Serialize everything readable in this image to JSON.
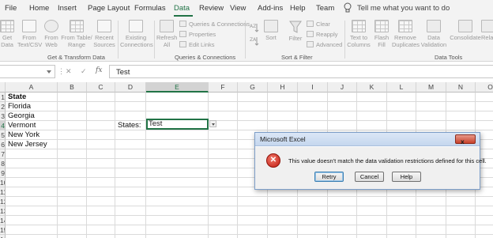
{
  "ribbon_tabs": [
    {
      "id": "file",
      "label": "File"
    },
    {
      "id": "home",
      "label": "Home"
    },
    {
      "id": "insert",
      "label": "Insert"
    },
    {
      "id": "page_layout",
      "label": "Page Layout"
    },
    {
      "id": "formulas",
      "label": "Formulas"
    },
    {
      "id": "data",
      "label": "Data",
      "active": true
    },
    {
      "id": "review",
      "label": "Review"
    },
    {
      "id": "view",
      "label": "View"
    },
    {
      "id": "addins",
      "label": "Add-ins"
    },
    {
      "id": "help",
      "label": "Help"
    },
    {
      "id": "team",
      "label": "Team"
    }
  ],
  "tell_me": "Tell me what you want to do",
  "ribbon": {
    "get_data": "Get\nData",
    "from_text_csv": "From\nText/CSV",
    "from_web": "From\nWeb",
    "from_table_range": "From Table/\nRange",
    "recent_sources": "Recent\nSources",
    "existing_connections": "Existing\nConnections",
    "refresh_all": "Refresh\nAll",
    "queries_connections": "Queries & Connections",
    "properties": "Properties",
    "edit_links": "Edit Links",
    "sort": "Sort",
    "filter": "Filter",
    "clear": "Clear",
    "reapply": "Reapply",
    "advanced": "Advanced",
    "text_to_columns": "Text to\nColumns",
    "flash_fill": "Flash\nFill",
    "remove_duplicates": "Remove\nDuplicates",
    "data_validation": "Data\nValidation",
    "consolidate": "Consolidate",
    "relationships": "Rela",
    "groups": {
      "get_transform": "Get & Transform Data",
      "queries": "Queries & Connections",
      "sort_filter": "Sort & Filter",
      "data_tools": "Data Tools"
    }
  },
  "formula_bar": {
    "name_box": "",
    "cancel_symbol": "✕",
    "enter_symbol": "✓",
    "fx_symbol": "fx",
    "value": "Test"
  },
  "columns": [
    "A",
    "B",
    "C",
    "D",
    "E",
    "F",
    "G",
    "H",
    "I",
    "J",
    "K",
    "L",
    "M",
    "N",
    "O"
  ],
  "rows": [
    "1",
    "2",
    "3",
    "4",
    "5",
    "6",
    "7",
    "8",
    "9",
    "10",
    "11",
    "12",
    "13",
    "14",
    "15",
    "16"
  ],
  "cells": {
    "A1": "State",
    "A2": "Florida",
    "A3": "Georgia",
    "A4": "Vermont",
    "A5": "New York",
    "A6": "New Jersey",
    "D4": "States:",
    "E4": "Test"
  },
  "active_cell": "E4",
  "dialog": {
    "title": "Microsoft Excel",
    "close_symbol": "x",
    "error_symbol": "✕",
    "message": "This value doesn't match the data validation restrictions defined for this cell.",
    "buttons": {
      "retry": "Retry",
      "cancel": "Cancel",
      "help": "Help"
    }
  }
}
